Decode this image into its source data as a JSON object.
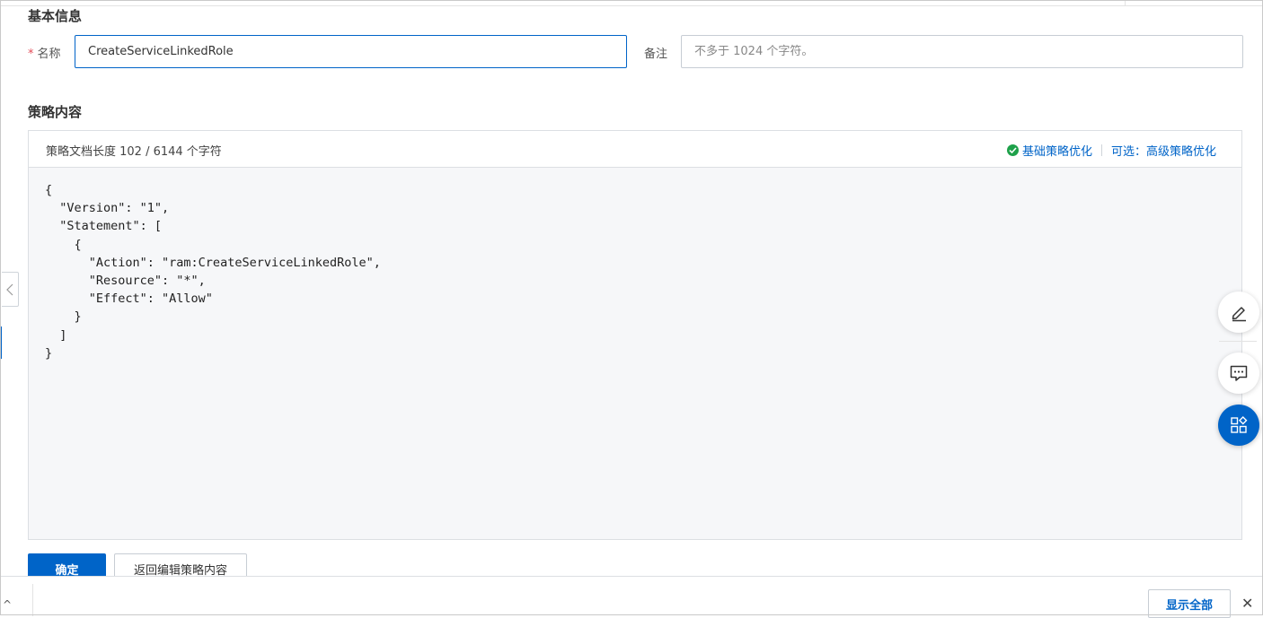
{
  "basic_info": {
    "title": "基本信息",
    "name_label": "名称",
    "required_mark": "*",
    "name_value": "CreateServiceLinkedRole",
    "remark_label": "备注",
    "remark_placeholder": "不多于 1024 个字符。"
  },
  "policy": {
    "title": "策略内容",
    "length_text": "策略文档长度 102 / 6144 个字符",
    "basic_optimize": "基础策略优化",
    "advanced_optimize": "可选：高级策略优化",
    "code": "{\n  \"Version\": \"1\",\n  \"Statement\": [\n    {\n      \"Action\": \"ram:CreateServiceLinkedRole\",\n      \"Resource\": \"*\",\n      \"Effect\": \"Allow\"\n    }\n  ]\n}"
  },
  "actions": {
    "confirm": "确定",
    "back": "返回编辑策略内容"
  },
  "bottom_bar": {
    "show_all": "显示全部",
    "close": "✕",
    "caret": "^"
  },
  "icons": {
    "side_collapse": "chevron-left-icon",
    "float_edit": "edit-icon",
    "float_feedback": "chat-icon",
    "float_apps": "apps-icon",
    "basic_optimize_status": "check-circle-icon"
  },
  "colors": {
    "primary": "#0064c8",
    "success": "#1ea14a",
    "required": "#e34d59"
  }
}
